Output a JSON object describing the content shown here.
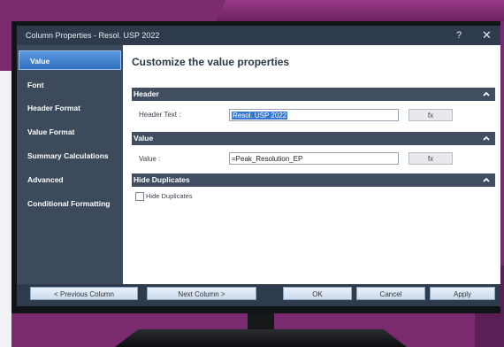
{
  "window": {
    "title": "Column Properties - Resol. USP 2022",
    "help_label": "?",
    "close_label": "✕"
  },
  "sidebar": {
    "items": [
      {
        "label": "Value",
        "active": true
      },
      {
        "label": "Font",
        "active": false
      },
      {
        "label": "Header Format",
        "active": false
      },
      {
        "label": "Value Format",
        "active": false
      },
      {
        "label": "Summary Calculations",
        "active": false
      },
      {
        "label": "Advanced",
        "active": false
      },
      {
        "label": "Conditional Formatting",
        "active": false
      }
    ]
  },
  "main": {
    "heading": "Customize the value properties",
    "sections": {
      "header": {
        "title": "Header",
        "field_label": "Header Text :",
        "field_value": "Resol. USP 2022",
        "fx_label": "fx"
      },
      "value": {
        "title": "Value",
        "field_label": "Value :",
        "field_value": "=Peak_Resolution_EP",
        "fx_label": "fx"
      },
      "hide_duplicates": {
        "title": "Hide Duplicates",
        "checkbox_label": "Hide Duplicates",
        "checked": false
      }
    }
  },
  "footer": {
    "prev_label": "< Previous Column",
    "next_label": "Next Column >",
    "ok_label": "OK",
    "cancel_label": "Cancel",
    "apply_label": "Apply"
  },
  "icons": {
    "collapse": "chevron-up-icon"
  },
  "colors": {
    "accent": "#3478d6",
    "section_bar": "#414e61",
    "sidebar": "#3c4a5c",
    "window_frame": "#2e3b4c"
  }
}
